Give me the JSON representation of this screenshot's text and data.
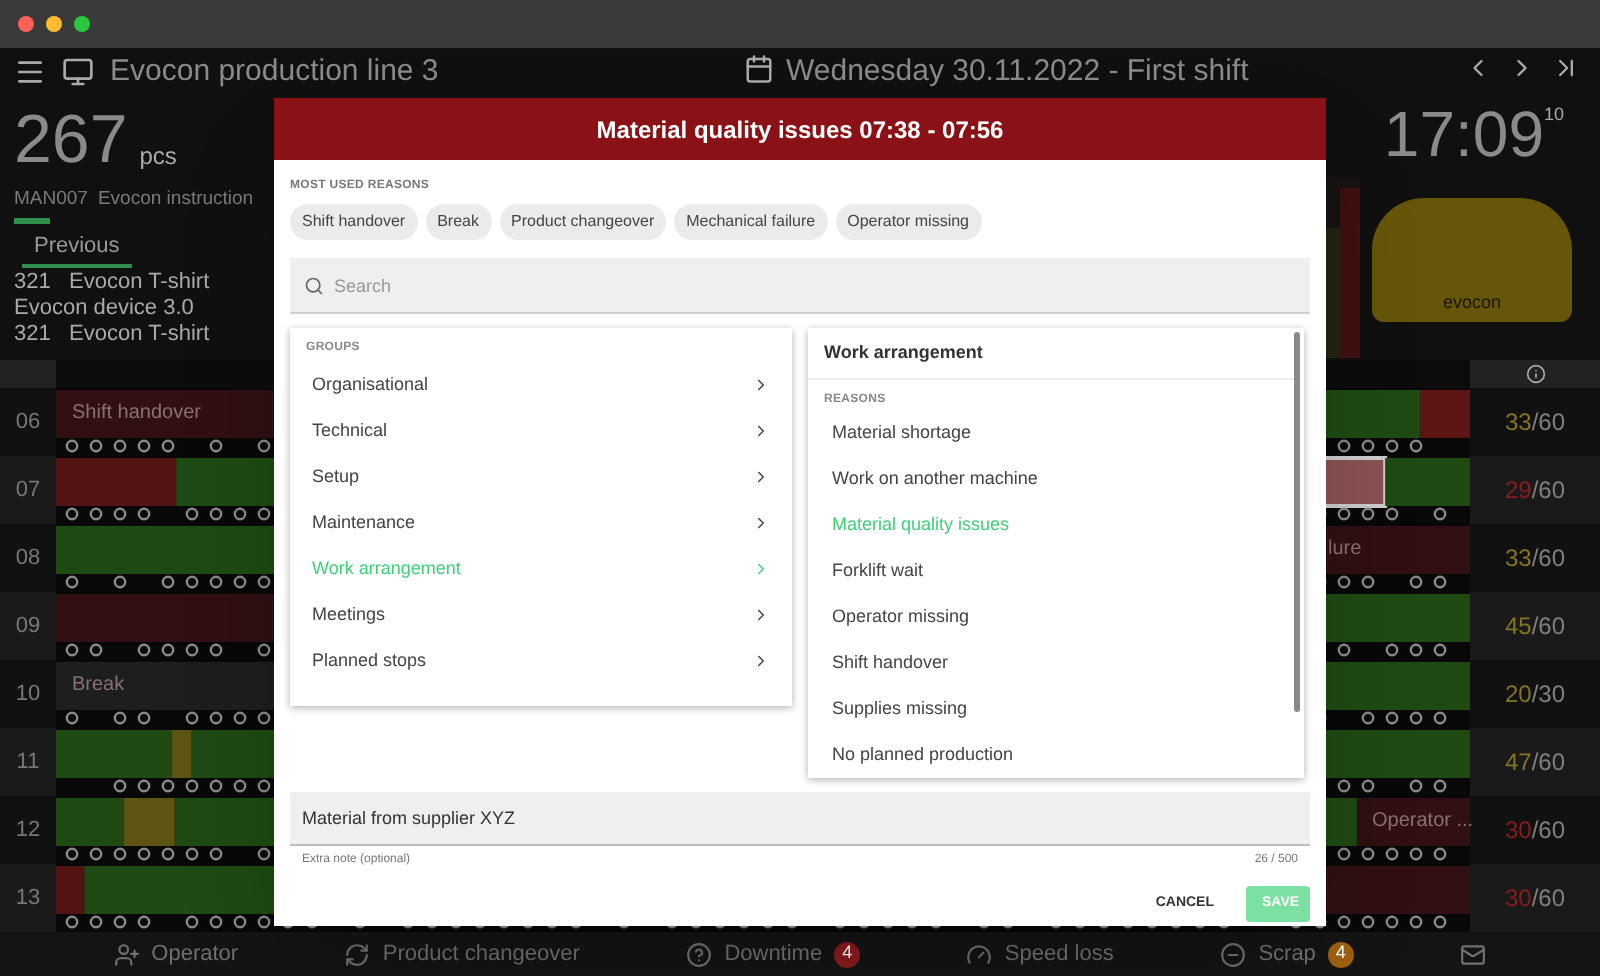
{
  "dashboard": {
    "line_title": "Evocon production line 3",
    "shift_title": "Wednesday 30.11.2022 - First shift",
    "quantity": "267",
    "quantity_unit": "pcs",
    "order_code": "MAN007",
    "order_name": "Evocon instruction",
    "previous_tab": "Previous",
    "products": [
      "321   Evocon T-shirt",
      "Evocon device 3.0",
      "321   Evocon T-shirt"
    ],
    "clock": "17:09",
    "clock_seconds": "10",
    "mascot_text": "evocon"
  },
  "rows": [
    {
      "hour": "06",
      "done": "33",
      "target": "/60",
      "color": "#857420",
      "label": "Shift handover"
    },
    {
      "hour": "07",
      "done": "29",
      "target": "/60",
      "color": "#8a1c1c"
    },
    {
      "hour": "08",
      "done": "33",
      "target": "/60",
      "color": "#857420",
      "label": "lure"
    },
    {
      "hour": "09",
      "done": "45",
      "target": "/60",
      "color": "#857420"
    },
    {
      "hour": "10",
      "done": "20",
      "target": "/30",
      "color": "#857420",
      "label": "Break"
    },
    {
      "hour": "11",
      "done": "47",
      "target": "/60",
      "color": "#857420"
    },
    {
      "hour": "12",
      "done": "30",
      "target": "/60",
      "color": "#8a1c1c",
      "label": "Operator ..."
    },
    {
      "hour": "13",
      "done": "30",
      "target": "/60",
      "color": "#8a1c1c"
    }
  ],
  "bottom_bar": [
    {
      "kind": "operator",
      "label": "Operator"
    },
    {
      "kind": "changeover",
      "label": "Product changeover"
    },
    {
      "kind": "downtime",
      "label": "Downtime",
      "badge": "4",
      "color": "#8a1c1c"
    },
    {
      "kind": "speed",
      "label": "Speed loss"
    },
    {
      "kind": "scrap",
      "label": "Scrap",
      "badge": "4",
      "color": "#a0600f"
    },
    {
      "kind": "mail"
    }
  ],
  "modal": {
    "title": "Material quality issues 07:38 - 07:56",
    "most_used_label": "MOST USED REASONS",
    "chips": [
      "Shift handover",
      "Break",
      "Product changeover",
      "Mechanical failure",
      "Operator missing"
    ],
    "search": {
      "placeholder": "Search"
    },
    "groups_label": "GROUPS",
    "groups": [
      {
        "label": "Organisational",
        "selected": false
      },
      {
        "label": "Technical",
        "selected": false
      },
      {
        "label": "Setup",
        "selected": false
      },
      {
        "label": "Maintenance",
        "selected": false
      },
      {
        "label": "Work arrangement",
        "selected": true
      },
      {
        "label": "Meetings",
        "selected": false
      },
      {
        "label": "Planned stops",
        "selected": false
      }
    ],
    "reasons_title": "Work arrangement",
    "reasons_label": "REASONS",
    "reasons": [
      {
        "label": "Material shortage",
        "selected": false
      },
      {
        "label": "Work on another machine",
        "selected": false
      },
      {
        "label": "Material quality issues",
        "selected": true
      },
      {
        "label": "Forklift wait",
        "selected": false
      },
      {
        "label": "Operator missing",
        "selected": false
      },
      {
        "label": "Shift handover",
        "selected": false
      },
      {
        "label": "Supplies missing",
        "selected": false
      },
      {
        "label": "No planned production",
        "selected": false
      }
    ],
    "note": {
      "value": "Material from supplier XYZ",
      "helper": "Extra note (optional)",
      "counter": "26 / 500"
    },
    "buttons": [
      {
        "kind": "cancel",
        "label": "CANCEL"
      },
      {
        "kind": "save",
        "label": "SAVE"
      }
    ]
  }
}
